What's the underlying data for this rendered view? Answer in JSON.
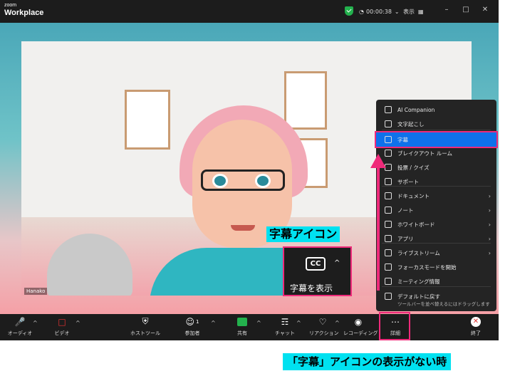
{
  "titlebar": {
    "logo_small": "zoom",
    "logo_big": "Workplace",
    "timer": "00:00:38",
    "view_label": "表示",
    "minimize_glyph": "–",
    "maximize_glyph": "□",
    "close_glyph": "✕"
  },
  "video": {
    "participant_name": "Hanako"
  },
  "callout": {
    "label": "字幕アイコン",
    "cc_text": "CC",
    "show_captions": "字幕を表示"
  },
  "menu": {
    "items": [
      {
        "label": "AI Companion",
        "icon": "sparkle-icon",
        "arrow": ""
      },
      {
        "label": "文字起こし",
        "icon": "transcript-icon",
        "arrow": ""
      },
      {
        "label": "字幕",
        "icon": "cc-icon",
        "arrow": ""
      },
      {
        "label": "ブレイクアウト ルーム",
        "icon": "breakout-icon",
        "arrow": ""
      },
      {
        "label": "投票 / クイズ",
        "icon": "poll-icon",
        "arrow": ""
      },
      {
        "label": "サポート",
        "icon": "support-icon",
        "arrow": ""
      },
      {
        "label": "ドキュメント",
        "icon": "document-icon",
        "arrow": "›"
      },
      {
        "label": "ノート",
        "icon": "notes-icon",
        "arrow": "›"
      },
      {
        "label": "ホワイトボード",
        "icon": "whiteboard-icon",
        "arrow": "›"
      },
      {
        "label": "アプリ",
        "icon": "apps-icon",
        "arrow": "›"
      },
      {
        "label": "ライブストリーム",
        "icon": "livestream-icon",
        "arrow": "›"
      },
      {
        "label": "フォーカスモードを開始",
        "icon": "focus-icon",
        "arrow": ""
      },
      {
        "label": "ミーティング情報",
        "icon": "info-icon",
        "arrow": ""
      },
      {
        "label": "デフォルトに戻す",
        "icon": "reset-icon",
        "arrow": ""
      }
    ],
    "reset_sub": "ツールバーを並べ替えるにはドラッグします"
  },
  "toolbar": {
    "audio": "オーディオ",
    "video": "ビデオ",
    "host_tools": "ホストツール",
    "participants": "参加者",
    "participants_count": "1",
    "share": "共有",
    "chat": "チャット",
    "reactions": "リアクション",
    "recording": "レコーディング",
    "more": "詳細",
    "end": "終了"
  },
  "caption": "「字幕」アイコンの表示がない時",
  "colors": {
    "accent_pink": "#ef2a7a",
    "highlight_cyan": "#00e1f0",
    "menu_selected": "#0e71eb",
    "share_green": "#23b14d"
  }
}
